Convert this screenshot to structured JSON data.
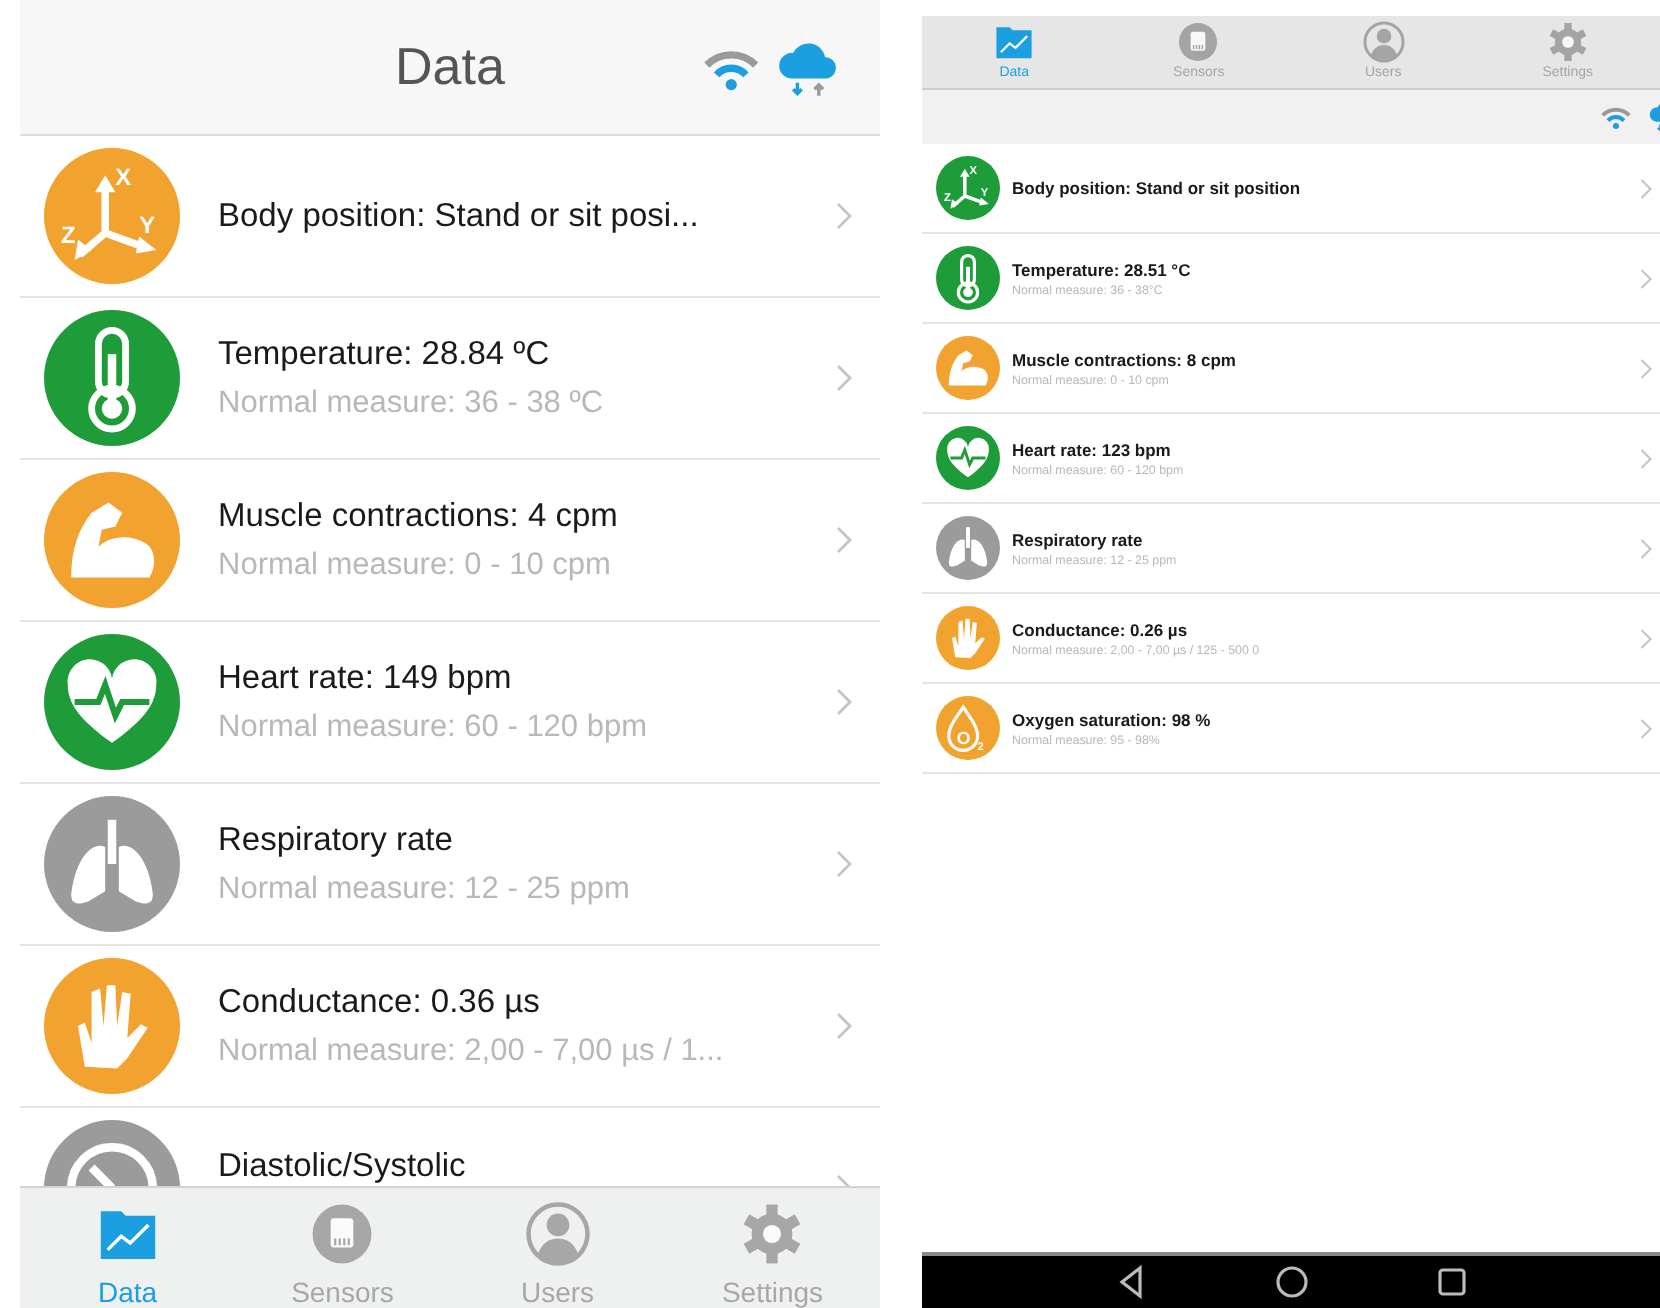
{
  "ios_screen": {
    "header": {
      "title": "Data"
    },
    "items": [
      {
        "kind": "axes",
        "color": "#f2a22f",
        "icon_labels": [
          "X",
          "Y",
          "Z"
        ],
        "title": "Body position: Stand or sit posi..."
      },
      {
        "kind": "thermometer",
        "color": "#1f9c3a",
        "title": "Temperature: 28.84 ºC",
        "subtitle": "Normal measure: 36 - 38 ºC"
      },
      {
        "kind": "arm",
        "color": "#f2a22f",
        "title": "Muscle contractions: 4 cpm",
        "subtitle": "Normal measure: 0 - 10 cpm"
      },
      {
        "kind": "heart",
        "color": "#1f9c3a",
        "title": "Heart rate: 149 bpm",
        "subtitle": "Normal measure: 60 - 120 bpm"
      },
      {
        "kind": "lungs",
        "color": "#9b9b9b",
        "title": "Respiratory rate",
        "subtitle": "Normal measure: 12 - 25 ppm"
      },
      {
        "kind": "hand",
        "color": "#f2a22f",
        "title": "Conductance: 0.36 µs",
        "subtitle": "Normal measure: 2,00 - 7,00 µs / 1..."
      },
      {
        "kind": "gauge",
        "color": "#9b9b9b",
        "title": "Diastolic/Systolic"
      }
    ],
    "tabs": [
      {
        "kind": "data",
        "label": "Data",
        "selected": true
      },
      {
        "kind": "sensors",
        "label": "Sensors",
        "selected": false
      },
      {
        "kind": "users",
        "label": "Users",
        "selected": false
      },
      {
        "kind": "settings",
        "label": "Settings",
        "selected": false
      }
    ]
  },
  "android_screen": {
    "tabs": [
      {
        "kind": "data",
        "label": "Data",
        "selected": true
      },
      {
        "kind": "sensors",
        "label": "Sensors",
        "selected": false
      },
      {
        "kind": "users",
        "label": "Users",
        "selected": false
      },
      {
        "kind": "settings",
        "label": "Settings",
        "selected": false
      }
    ],
    "items": [
      {
        "kind": "axes",
        "color": "#1f9c3a",
        "icon_labels": [
          "X",
          "Y",
          "Z"
        ],
        "title": "Body position: Stand or sit position"
      },
      {
        "kind": "thermometer",
        "color": "#1f9c3a",
        "title": "Temperature: 28.51 °C",
        "subtitle": "Normal measure: 36 - 38°C"
      },
      {
        "kind": "arm",
        "color": "#f2a22f",
        "title": "Muscle contractions: 8 cpm",
        "subtitle": "Normal measure: 0 - 10 cpm"
      },
      {
        "kind": "heart",
        "color": "#1f9c3a",
        "title": "Heart rate: 123 bpm",
        "subtitle": "Normal measure: 60 - 120 bpm"
      },
      {
        "kind": "lungs",
        "color": "#9b9b9b",
        "title": "Respiratory rate",
        "subtitle": "Normal measure: 12 - 25 ppm"
      },
      {
        "kind": "hand",
        "color": "#f2a22f",
        "title": "Conductance: 0.26 µs",
        "subtitle": "Normal measure: 2,00 - 7,00 µs / 125 - 500 0"
      },
      {
        "kind": "drop",
        "color": "#f2a22f",
        "icon_labels": [
          "O",
          "2"
        ],
        "title": "Oxygen saturation: 98 %",
        "subtitle": "Normal measure: 95 - 98%"
      }
    ]
  }
}
